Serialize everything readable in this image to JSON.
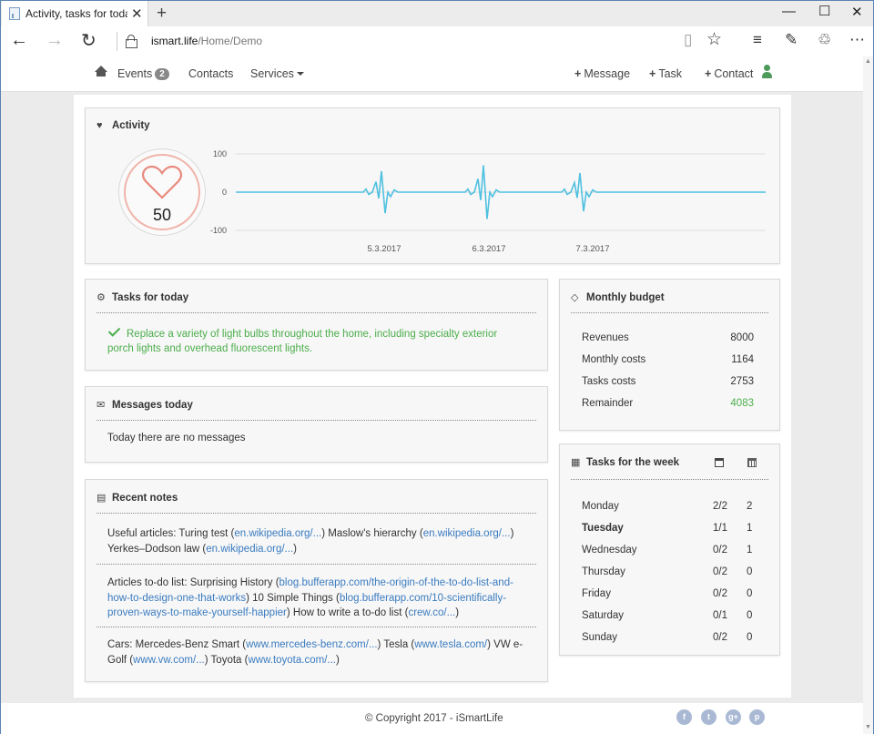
{
  "browser": {
    "tab_title": "Activity, tasks for today,",
    "url_host": "ismart.life",
    "url_path": "/Home/Demo"
  },
  "navbar": {
    "events_label": "Events",
    "events_badge": "2",
    "contacts_label": "Contacts",
    "services_label": "Services",
    "add_message_label": "Message",
    "add_task_label": "Task",
    "add_contact_label": "Contact"
  },
  "activity": {
    "title": "Activity",
    "heart_rate": "50",
    "chart_data": {
      "type": "line",
      "title": "",
      "y_ticks": [
        "100",
        "0",
        "-100"
      ],
      "ylim": [
        -100,
        100
      ],
      "x_labels": [
        "5.3.2017",
        "6.3.2017",
        "7.3.2017"
      ],
      "series": [
        {
          "values": [
            0,
            0,
            0,
            55,
            -55,
            0,
            0,
            0,
            70,
            -60,
            0,
            0,
            0,
            50,
            -50,
            0,
            0,
            0
          ]
        }
      ],
      "color": "#4fc0e0"
    }
  },
  "tasks_today": {
    "title": "Tasks for today",
    "task": "Replace a variety of light bulbs throughout the home, including specialty exterior porch lights and overhead fluorescent lights."
  },
  "messages_today": {
    "title": "Messages today",
    "empty": "Today there are no messages"
  },
  "recent_notes": {
    "title": "Recent notes",
    "n1_a": "Useful articles: Turing test (",
    "n1_l1": "en.wikipedia.org/...",
    "n1_b": ") Maslow's hierarchy (",
    "n1_l2": "en.wikipedia.org/...",
    "n1_c": ") Yerkes–Dodson law (",
    "n1_l3": "en.wikipedia.org/...",
    "n1_d": ")",
    "n2_a": "Articles to-do list: Surprising History (",
    "n2_l1": "blog.bufferapp.com/the-origin-of-the-to-do-list-and-how-to-design-one-that-works",
    "n2_b": ") 10 Simple Things (",
    "n2_l2": "blog.bufferapp.com/10-scientifically-proven-ways-to-make-yourself-happier",
    "n2_c": ") How to write a to-do list (",
    "n2_l3": "crew.co/...",
    "n2_d": ")",
    "n3_a": "Cars: Mercedes-Benz Smart (",
    "n3_l1": "www.mercedes-benz.com/...",
    "n3_b": ") Tesla (",
    "n3_l2": "www.tesla.com/",
    "n3_c": ") VW e-Golf (",
    "n3_l3": "www.vw.com/...",
    "n3_d": ") Toyota (",
    "n3_l4": "www.toyota.com/...",
    "n3_e": ")"
  },
  "budget": {
    "title": "Monthly budget",
    "rows": [
      {
        "label": "Revenues",
        "value": "8000"
      },
      {
        "label": "Monthly costs",
        "value": "1164"
      },
      {
        "label": "Tasks costs",
        "value": "2753"
      },
      {
        "label": "Remainder",
        "value": "4083"
      }
    ],
    "remainder_color": "#4cae4c"
  },
  "week": {
    "title": "Tasks for the week",
    "rows": [
      {
        "day": "Monday",
        "done": "2/2",
        "count": "2"
      },
      {
        "day": "Tuesday",
        "done": "1/1",
        "count": "1"
      },
      {
        "day": "Wednesday",
        "done": "0/2",
        "count": "1"
      },
      {
        "day": "Thursday",
        "done": "0/2",
        "count": "0"
      },
      {
        "day": "Friday",
        "done": "0/2",
        "count": "0"
      },
      {
        "day": "Saturday",
        "done": "0/1",
        "count": "0"
      },
      {
        "day": "Sunday",
        "done": "0/2",
        "count": "0"
      }
    ]
  },
  "footer": {
    "copyright": "© Copyright 2017 - iSmartLife",
    "social": [
      "f",
      "t",
      "g+",
      "p"
    ]
  }
}
